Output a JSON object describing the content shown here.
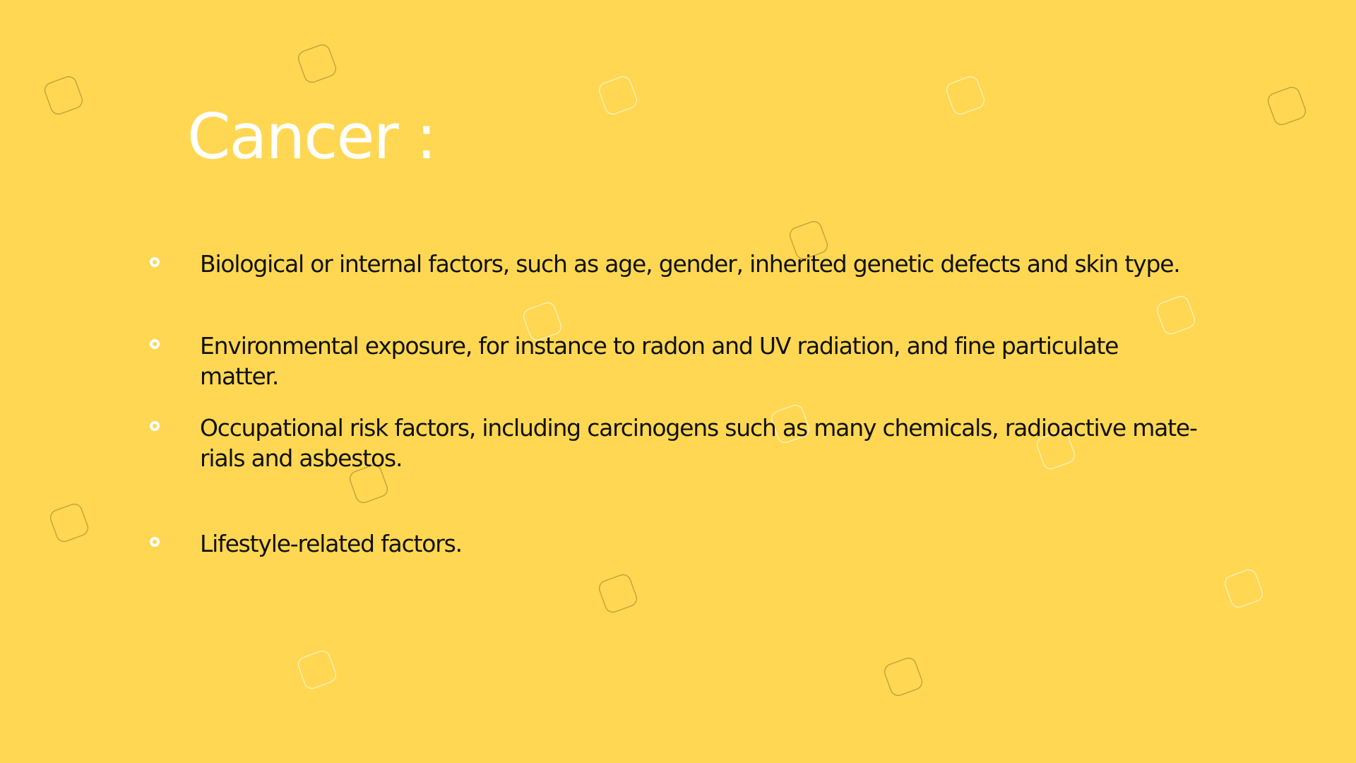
{
  "slide": {
    "title": "Cancer :",
    "bullets": [
      "Biological or internal factors, such as age, gender, inherited genetic defects and skin type.",
      "Environmental exposure, for instance to radon and UV radiation, and fine particulate matter.",
      "Occupational risk factors, including carcinogens such as many chemicals, radioactive mate-rials and asbestos.",
      "Lifestyle-related factors."
    ]
  },
  "colors": {
    "background": "#FFD752",
    "title": "#FFFFFF",
    "body_text": "#111111",
    "bullet_marker": "#FFFFFF"
  },
  "icons": {
    "bullet": "ring-bullet-icon",
    "decoration": "rounded-square-decoration"
  }
}
